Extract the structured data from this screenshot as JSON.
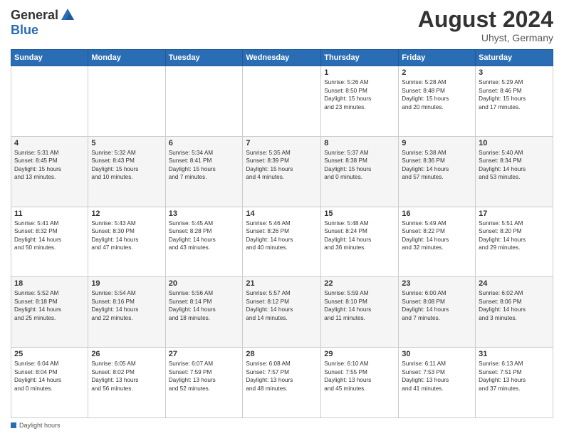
{
  "header": {
    "logo_general": "General",
    "logo_blue": "Blue",
    "month_title": "August 2024",
    "subtitle": "Uhyst, Germany"
  },
  "days_header": [
    "Sunday",
    "Monday",
    "Tuesday",
    "Wednesday",
    "Thursday",
    "Friday",
    "Saturday"
  ],
  "footer": {
    "label": "Daylight hours"
  },
  "weeks": [
    [
      {
        "day": "",
        "info": ""
      },
      {
        "day": "",
        "info": ""
      },
      {
        "day": "",
        "info": ""
      },
      {
        "day": "",
        "info": ""
      },
      {
        "day": "1",
        "info": "Sunrise: 5:26 AM\nSunset: 8:50 PM\nDaylight: 15 hours\nand 23 minutes."
      },
      {
        "day": "2",
        "info": "Sunrise: 5:28 AM\nSunset: 8:48 PM\nDaylight: 15 hours\nand 20 minutes."
      },
      {
        "day": "3",
        "info": "Sunrise: 5:29 AM\nSunset: 8:46 PM\nDaylight: 15 hours\nand 17 minutes."
      }
    ],
    [
      {
        "day": "4",
        "info": "Sunrise: 5:31 AM\nSunset: 8:45 PM\nDaylight: 15 hours\nand 13 minutes."
      },
      {
        "day": "5",
        "info": "Sunrise: 5:32 AM\nSunset: 8:43 PM\nDaylight: 15 hours\nand 10 minutes."
      },
      {
        "day": "6",
        "info": "Sunrise: 5:34 AM\nSunset: 8:41 PM\nDaylight: 15 hours\nand 7 minutes."
      },
      {
        "day": "7",
        "info": "Sunrise: 5:35 AM\nSunset: 8:39 PM\nDaylight: 15 hours\nand 4 minutes."
      },
      {
        "day": "8",
        "info": "Sunrise: 5:37 AM\nSunset: 8:38 PM\nDaylight: 15 hours\nand 0 minutes."
      },
      {
        "day": "9",
        "info": "Sunrise: 5:38 AM\nSunset: 8:36 PM\nDaylight: 14 hours\nand 57 minutes."
      },
      {
        "day": "10",
        "info": "Sunrise: 5:40 AM\nSunset: 8:34 PM\nDaylight: 14 hours\nand 53 minutes."
      }
    ],
    [
      {
        "day": "11",
        "info": "Sunrise: 5:41 AM\nSunset: 8:32 PM\nDaylight: 14 hours\nand 50 minutes."
      },
      {
        "day": "12",
        "info": "Sunrise: 5:43 AM\nSunset: 8:30 PM\nDaylight: 14 hours\nand 47 minutes."
      },
      {
        "day": "13",
        "info": "Sunrise: 5:45 AM\nSunset: 8:28 PM\nDaylight: 14 hours\nand 43 minutes."
      },
      {
        "day": "14",
        "info": "Sunrise: 5:46 AM\nSunset: 8:26 PM\nDaylight: 14 hours\nand 40 minutes."
      },
      {
        "day": "15",
        "info": "Sunrise: 5:48 AM\nSunset: 8:24 PM\nDaylight: 14 hours\nand 36 minutes."
      },
      {
        "day": "16",
        "info": "Sunrise: 5:49 AM\nSunset: 8:22 PM\nDaylight: 14 hours\nand 32 minutes."
      },
      {
        "day": "17",
        "info": "Sunrise: 5:51 AM\nSunset: 8:20 PM\nDaylight: 14 hours\nand 29 minutes."
      }
    ],
    [
      {
        "day": "18",
        "info": "Sunrise: 5:52 AM\nSunset: 8:18 PM\nDaylight: 14 hours\nand 25 minutes."
      },
      {
        "day": "19",
        "info": "Sunrise: 5:54 AM\nSunset: 8:16 PM\nDaylight: 14 hours\nand 22 minutes."
      },
      {
        "day": "20",
        "info": "Sunrise: 5:56 AM\nSunset: 8:14 PM\nDaylight: 14 hours\nand 18 minutes."
      },
      {
        "day": "21",
        "info": "Sunrise: 5:57 AM\nSunset: 8:12 PM\nDaylight: 14 hours\nand 14 minutes."
      },
      {
        "day": "22",
        "info": "Sunrise: 5:59 AM\nSunset: 8:10 PM\nDaylight: 14 hours\nand 11 minutes."
      },
      {
        "day": "23",
        "info": "Sunrise: 6:00 AM\nSunset: 8:08 PM\nDaylight: 14 hours\nand 7 minutes."
      },
      {
        "day": "24",
        "info": "Sunrise: 6:02 AM\nSunset: 8:06 PM\nDaylight: 14 hours\nand 3 minutes."
      }
    ],
    [
      {
        "day": "25",
        "info": "Sunrise: 6:04 AM\nSunset: 8:04 PM\nDaylight: 14 hours\nand 0 minutes."
      },
      {
        "day": "26",
        "info": "Sunrise: 6:05 AM\nSunset: 8:02 PM\nDaylight: 13 hours\nand 56 minutes."
      },
      {
        "day": "27",
        "info": "Sunrise: 6:07 AM\nSunset: 7:59 PM\nDaylight: 13 hours\nand 52 minutes."
      },
      {
        "day": "28",
        "info": "Sunrise: 6:08 AM\nSunset: 7:57 PM\nDaylight: 13 hours\nand 48 minutes."
      },
      {
        "day": "29",
        "info": "Sunrise: 6:10 AM\nSunset: 7:55 PM\nDaylight: 13 hours\nand 45 minutes."
      },
      {
        "day": "30",
        "info": "Sunrise: 6:11 AM\nSunset: 7:53 PM\nDaylight: 13 hours\nand 41 minutes."
      },
      {
        "day": "31",
        "info": "Sunrise: 6:13 AM\nSunset: 7:51 PM\nDaylight: 13 hours\nand 37 minutes."
      }
    ]
  ]
}
